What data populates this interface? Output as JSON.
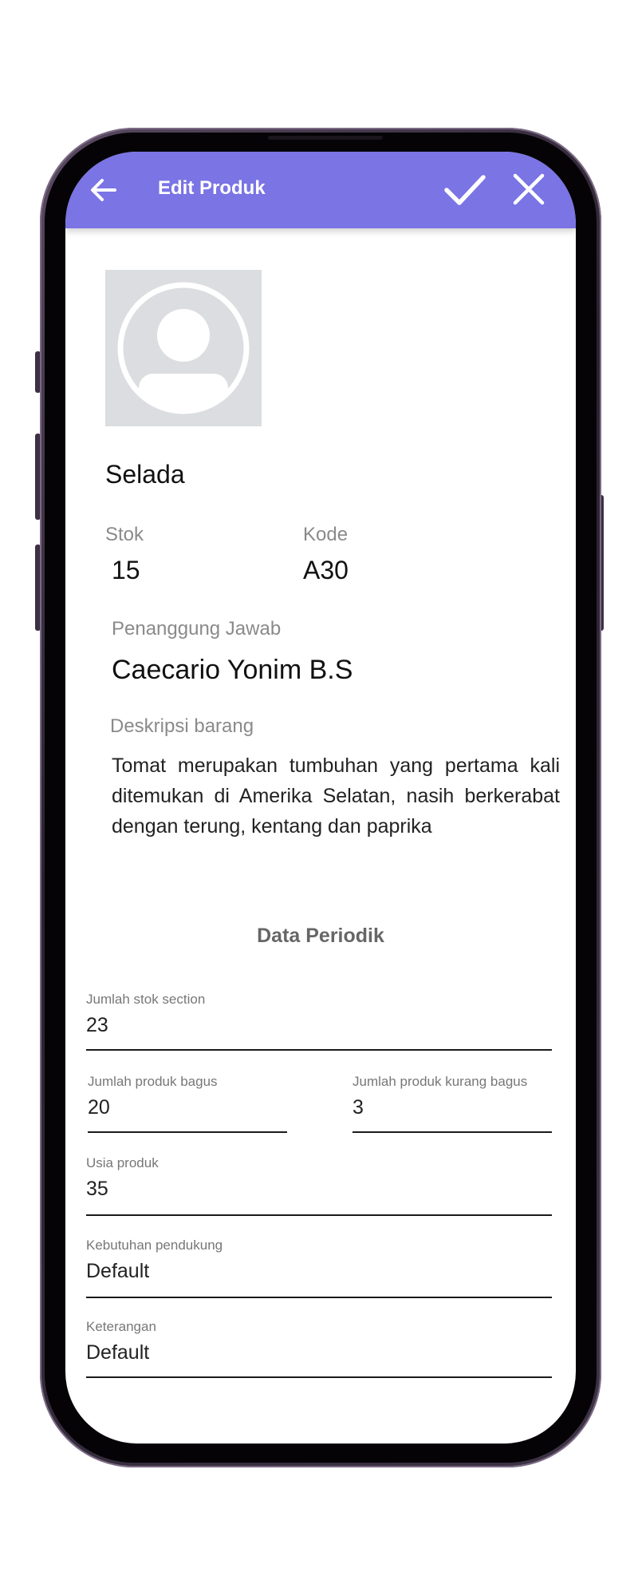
{
  "appbar": {
    "title": "Edit Produk",
    "color": "#7a74e5"
  },
  "product": {
    "name": "Selada",
    "stok_label": "Stok",
    "stok_value": "15",
    "kode_label": "Kode",
    "kode_value": "A30",
    "pj_label": "Penanggung Jawab",
    "pj_value": "Caecario Yonim B.S",
    "desc_label": "Deskripsi barang",
    "desc_text": "Tomat merupakan tumbuhan yang pertama kali ditemukan di Amerika Selatan, nasih berkerabat dengan terung, kentang dan paprika"
  },
  "periodic": {
    "title": "Data Periodik",
    "fields": [
      {
        "label": "Jumlah stok section",
        "value": "23"
      },
      {
        "label": "Jumlah produk bagus",
        "value": "20"
      },
      {
        "label": "Jumlah produk kurang bagus",
        "value": "3"
      },
      {
        "label": "Usia produk",
        "value": "35"
      },
      {
        "label": "Kebutuhan pendukung",
        "value": "Default"
      },
      {
        "label": "Keterangan",
        "value": "Default"
      }
    ]
  },
  "icons": {
    "back": "arrow-left-icon",
    "save": "check-icon",
    "cancel": "close-icon",
    "avatar": "user-placeholder-icon"
  }
}
